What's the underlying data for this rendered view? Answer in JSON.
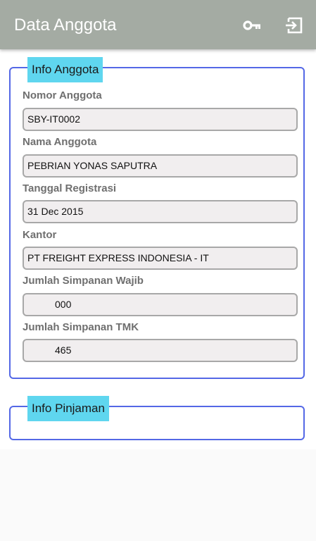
{
  "appbar": {
    "title": "Data Anggota",
    "icons": [
      "key-icon",
      "logout-icon"
    ]
  },
  "info_anggota": {
    "legend": "Info Anggota",
    "fields": [
      {
        "label": "Nomor Anggota",
        "value": "SBY-IT0002"
      },
      {
        "label": "Nama Anggota",
        "value": "PEBRIAN YONAS SAPUTRA"
      },
      {
        "label": "Tanggal Registrasi",
        "value": "31 Dec 2015"
      },
      {
        "label": "Kantor",
        "value": "PT FREIGHT EXPRESS INDONESIA - IT"
      },
      {
        "label": "Jumlah Simpanan Wajib",
        "value": "000"
      },
      {
        "label": "Jumlah Simpanan TMK",
        "value": "465"
      }
    ]
  },
  "info_pinjaman": {
    "legend": "Info Pinjaman"
  },
  "colors": {
    "appbar": "#a4aba3",
    "panel_border": "#5468e6",
    "legend_bg": "#5fd6ef",
    "field_bg": "#f1eeef",
    "field_border": "#a8a8a8",
    "label": "#6f6f6f"
  }
}
